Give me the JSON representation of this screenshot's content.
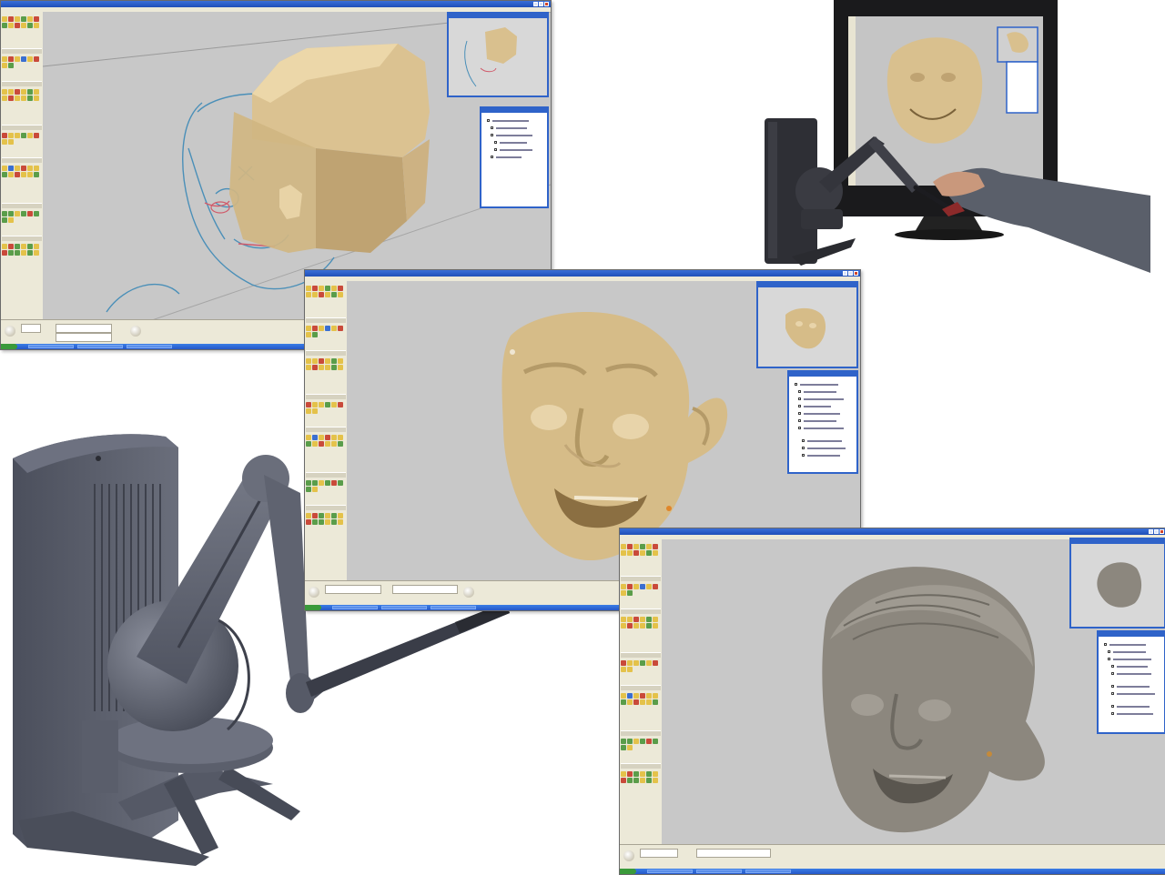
{
  "screenshots": [
    {
      "id": "shot-1",
      "title": "",
      "model": "tan-head-block-out-with-sketch"
    },
    {
      "id": "shot-2",
      "title": "",
      "model": "tan-grinning-face"
    },
    {
      "id": "shot-3",
      "title": "",
      "model": "gray-head-with-hair"
    }
  ],
  "photos": [
    {
      "id": "monitor-photo",
      "subject": "haptic-device-with-monitor"
    },
    {
      "id": "device-render",
      "subject": "haptic-arm-device"
    }
  ],
  "colors": {
    "viewport_gray": "#c8c8c8",
    "clay_tan": "#d9c08e",
    "clay_gray": "#8c877e",
    "device_slate": "#5f6370",
    "xp_blue": "#2f63c9"
  }
}
